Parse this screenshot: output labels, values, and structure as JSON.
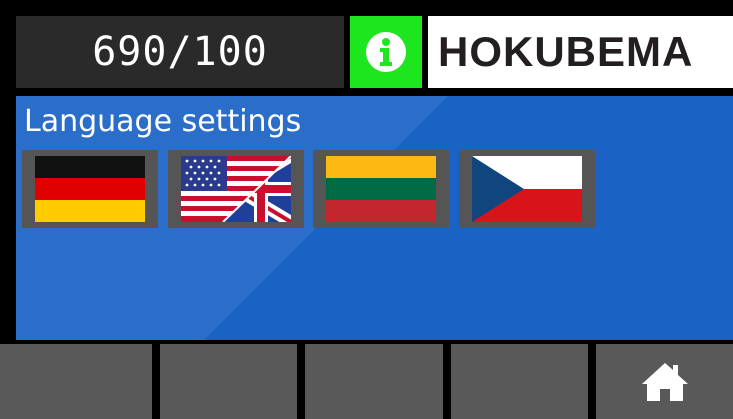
{
  "header": {
    "counter": "690/100",
    "info_icon": "info-icon",
    "logo_text": "HOKUBEMA"
  },
  "panel": {
    "title": "Language settings",
    "languages": [
      {
        "code": "de",
        "icon": "german-flag-icon"
      },
      {
        "code": "en",
        "icon": "us-uk-flag-icon"
      },
      {
        "code": "lt",
        "icon": "lithuanian-flag-icon"
      },
      {
        "code": "cs",
        "icon": "czech-flag-icon"
      }
    ]
  },
  "bottom_bar": {
    "buttons": [
      "",
      "",
      "",
      "",
      "home-icon"
    ]
  },
  "colors": {
    "panel_bg": "#1a63c5",
    "info_green": "#1ee61e",
    "button_gray": "#595959",
    "counter_bg": "#2a2a2a"
  }
}
